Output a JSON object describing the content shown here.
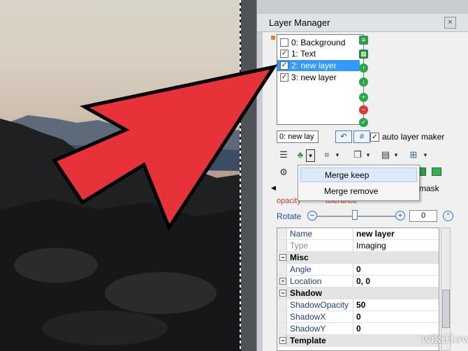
{
  "panel": {
    "title": "Layer Manager",
    "close_icon_text": "×"
  },
  "layers": [
    {
      "label": "0: Background",
      "checked": false,
      "selected": false
    },
    {
      "label": "1: Text",
      "checked": true,
      "selected": false
    },
    {
      "label": "2: new layer",
      "checked": true,
      "selected": true
    },
    {
      "label": "3: new layer",
      "checked": true,
      "selected": false
    }
  ],
  "name_input": {
    "value": "0: new lay",
    "btn1": "↶",
    "btn2": "#"
  },
  "auto_layer_maker": {
    "label": "auto layer maker",
    "checked": true
  },
  "merge_menu": {
    "items": [
      "Merge keep",
      "Merge remove"
    ]
  },
  "mask_label": "mask",
  "opacity_row": {
    "opacity": "opacity",
    "tolerance": "tolerance"
  },
  "rotate": {
    "label": "Rotate",
    "value": "0",
    "level_fraction": 0.5
  },
  "properties": [
    {
      "kind": "row",
      "key": "Name",
      "value": "new layer"
    },
    {
      "kind": "row",
      "key": "Type",
      "value": "Imaging",
      "dim": true
    },
    {
      "kind": "cat",
      "key": "Misc",
      "toggle": "−"
    },
    {
      "kind": "row",
      "key": "Angle",
      "value": "0"
    },
    {
      "kind": "row",
      "key": "Location",
      "value": "0, 0",
      "toggle": "+"
    },
    {
      "kind": "cat",
      "key": "Shadow",
      "toggle": "−"
    },
    {
      "kind": "row",
      "key": "ShadowOpacity",
      "value": "50"
    },
    {
      "kind": "row",
      "key": "ShadowX",
      "value": "0"
    },
    {
      "kind": "row",
      "key": "ShadowY",
      "value": "0"
    },
    {
      "kind": "cat",
      "key": "Template",
      "toggle": "−"
    }
  ],
  "watermark": "wikiHow",
  "colors": {
    "arrow": "#e8323a",
    "selection": "#3399ff",
    "accent_blue": "#1f4e9a"
  },
  "icons": [
    "close-icon",
    "layer-list-icon",
    "arrow-up-icon",
    "arrow-down-icon",
    "add-icon",
    "remove-icon",
    "confirm-icon",
    "merge-icon",
    "crop-icon",
    "copy-icon",
    "paste-icon",
    "hierarchy-icon",
    "lines-icon",
    "wrench-icon",
    "swatch-icon"
  ]
}
